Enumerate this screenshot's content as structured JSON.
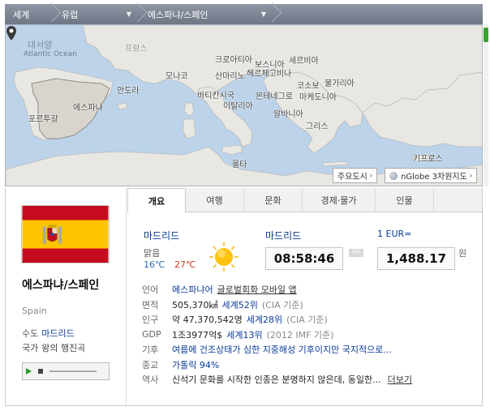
{
  "breadcrumb": {
    "world": "세계",
    "region": "유럽",
    "country": "에스파냐/스페인"
  },
  "map": {
    "labels": {
      "atlantic_ko": "대서양",
      "atlantic_en": "Atlantic Ocean",
      "france": "프랑스",
      "monaco": "모나코",
      "andorra": "안도라",
      "spain": "에스파냐",
      "portugal": "포르투갈",
      "croatia": "크로아티아",
      "sanmarino": "산마리노",
      "vatican": "바티칸시국",
      "italy": "이탈리아",
      "bosnia": "보스니아",
      "herzegovina": "헤르체고비나",
      "serbia": "세르비아",
      "montenegro": "몬테네그로",
      "kosovo": "코소보",
      "bulgaria": "불가리아",
      "macedonia": "마케도니아",
      "albania": "알바니아",
      "greece": "그리스",
      "malta": "몰타",
      "cyprus": "키프로스"
    },
    "buttons": {
      "major_cities": "주요도시",
      "nglobe": "nGlobe 3차원지도"
    }
  },
  "country": {
    "name": "에스파냐/스페인",
    "name_en": "Spain",
    "capital_label": "수도",
    "capital": "마드리드",
    "gov_label": "국가",
    "gov": "왕의 행진곡"
  },
  "tabs": [
    "개요",
    "여행",
    "문화",
    "경제·물가",
    "인물"
  ],
  "weather": {
    "city": "마드리드",
    "condition": "맑음",
    "low": "16℃",
    "high": "27℃"
  },
  "time": {
    "city": "마드리드",
    "value": "08:58:46",
    "ampm": "AM"
  },
  "exchange": {
    "label": "1 EUR=",
    "value": "1,488.17",
    "unit": "원"
  },
  "facts": {
    "language": {
      "k": "언어",
      "v": "에스파냐어",
      "link": "글로벌회화 모바일 앱"
    },
    "area": {
      "k": "면적",
      "v": "505,370㎢",
      "rank": "세계52위",
      "src": "(CIA 기준)"
    },
    "population": {
      "k": "인구",
      "v": "약 47,370,542명",
      "rank": "세계28위",
      "src": "(CIA 기준)"
    },
    "gdp": {
      "k": "GDP",
      "v": "1조3977억$",
      "rank": "세계13위",
      "src": "(2012 IMF 기준)"
    },
    "climate": {
      "k": "기후",
      "v": "여름에 건조상태가 심한 지중해성 기후이지만 국지적으로..."
    },
    "religion": {
      "k": "종교",
      "v": "가톨릭 94%"
    },
    "history": {
      "k": "역사",
      "v": "신석기 문화를 시작한 인종은 분명하지 않은데, 동일한...",
      "more": "더보기"
    }
  }
}
